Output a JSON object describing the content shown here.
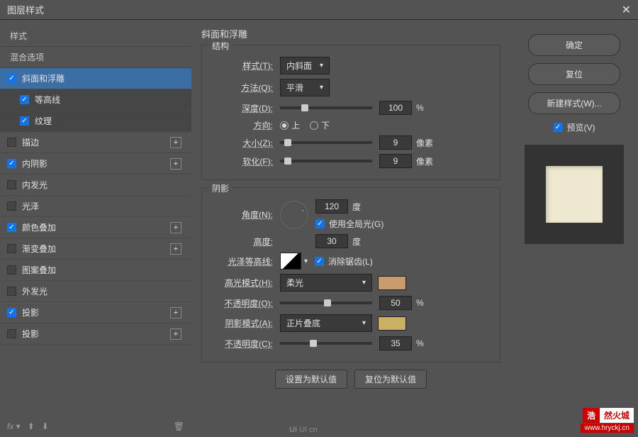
{
  "title": "图层样式",
  "sidebar": {
    "header_style": "样式",
    "header_blend": "混合选项",
    "items": [
      {
        "label": "斜面和浮雕",
        "checked": true,
        "selected": true,
        "plus": false,
        "sub": false
      },
      {
        "label": "等高线",
        "checked": true,
        "selected": false,
        "plus": false,
        "sub": true
      },
      {
        "label": "纹理",
        "checked": true,
        "selected": false,
        "plus": false,
        "sub": true
      },
      {
        "label": "描边",
        "checked": false,
        "selected": false,
        "plus": true,
        "sub": false
      },
      {
        "label": "内阴影",
        "checked": true,
        "selected": false,
        "plus": true,
        "sub": false
      },
      {
        "label": "内发光",
        "checked": false,
        "selected": false,
        "plus": false,
        "sub": false
      },
      {
        "label": "光泽",
        "checked": false,
        "selected": false,
        "plus": false,
        "sub": false
      },
      {
        "label": "颜色叠加",
        "checked": true,
        "selected": false,
        "plus": true,
        "sub": false
      },
      {
        "label": "渐变叠加",
        "checked": false,
        "selected": false,
        "plus": true,
        "sub": false
      },
      {
        "label": "图案叠加",
        "checked": false,
        "selected": false,
        "plus": false,
        "sub": false
      },
      {
        "label": "外发光",
        "checked": false,
        "selected": false,
        "plus": false,
        "sub": false
      },
      {
        "label": "投影",
        "checked": true,
        "selected": false,
        "plus": true,
        "sub": false
      },
      {
        "label": "投影",
        "checked": false,
        "selected": false,
        "plus": true,
        "sub": false
      }
    ],
    "fx_label": "fx"
  },
  "panel": {
    "title": "斜面和浮雕",
    "structure": {
      "group": "结构",
      "style_lbl": "样式(T):",
      "style_val": "内斜面",
      "technique_lbl": "方法(Q):",
      "technique_val": "平滑",
      "depth_lbl": "深度(D):",
      "depth_val": "100",
      "depth_unit": "%",
      "direction_lbl": "方向:",
      "dir_up": "上",
      "dir_down": "下",
      "size_lbl": "大小(Z):",
      "size_val": "9",
      "size_unit": "像素",
      "soften_lbl": "软化(F):",
      "soften_val": "9",
      "soften_unit": "像素"
    },
    "shading": {
      "group": "阴影",
      "angle_lbl": "角度(N):",
      "angle_val": "120",
      "angle_unit": "度",
      "global_light": "使用全局光(G)",
      "altitude_lbl": "高度:",
      "altitude_val": "30",
      "altitude_unit": "度",
      "gloss_lbl": "光泽等高线:",
      "antialias": "消除锯齿(L)",
      "highlight_mode_lbl": "高光模式(H):",
      "highlight_mode_val": "柔光",
      "highlight_color": "#c89c6e",
      "highlight_opacity_lbl": "不透明度(O):",
      "highlight_opacity_val": "50",
      "opacity_unit": "%",
      "shadow_mode_lbl": "阴影模式(A):",
      "shadow_mode_val": "正片叠底",
      "shadow_color": "#c9b063",
      "shadow_opacity_lbl": "不透明度(C):",
      "shadow_opacity_val": "35"
    },
    "set_default": "设置为默认值",
    "reset_default": "复位为默认值"
  },
  "right": {
    "ok": "确定",
    "reset": "复位",
    "new_style": "新建样式(W)...",
    "preview": "预览(V)"
  },
  "watermark": {
    "t1": "浩",
    "t2": "然火城",
    "url": "www.hryckj.cn"
  },
  "ui_logo": "UI cn"
}
